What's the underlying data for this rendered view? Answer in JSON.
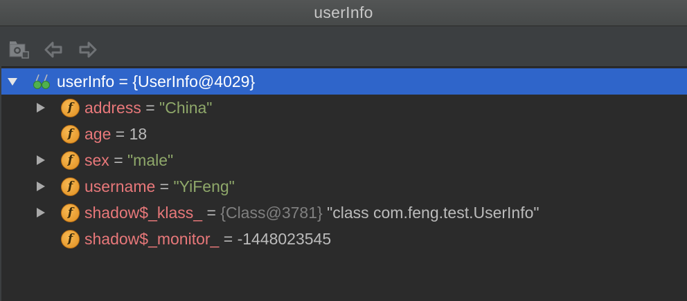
{
  "window": {
    "title": "userInfo"
  },
  "toolbar": {
    "buttons": [
      {
        "icon": "screenshot-icon"
      },
      {
        "icon": "back-arrow-icon"
      },
      {
        "icon": "forward-arrow-icon"
      }
    ]
  },
  "tree": {
    "root": {
      "name": "userInfo",
      "equals": "=",
      "value": "{UserInfo@4029}",
      "icon": "watch-glasses-icon",
      "expanded": true
    },
    "fields": [
      {
        "name": "address",
        "equals": "=",
        "value": "\"China\"",
        "kind": "string",
        "expandable": true,
        "icon_letter": "f"
      },
      {
        "name": "age",
        "equals": "=",
        "value": "18",
        "kind": "number",
        "expandable": false,
        "icon_letter": "f"
      },
      {
        "name": "sex",
        "equals": "=",
        "value": "\"male\"",
        "kind": "string",
        "expandable": true,
        "icon_letter": "f"
      },
      {
        "name": "username",
        "equals": "=",
        "value": "\"YiFeng\"",
        "kind": "string",
        "expandable": true,
        "icon_letter": "f"
      },
      {
        "name": "shadow$_klass_",
        "equals": "=",
        "ref": "{Class@3781}",
        "value": "\"class com.feng.test.UserInfo\"",
        "kind": "object",
        "expandable": true,
        "icon_letter": "f"
      },
      {
        "name": "shadow$_monitor_",
        "equals": "=",
        "value": "-1448023545",
        "kind": "number",
        "expandable": false,
        "icon_letter": "f"
      }
    ]
  },
  "colors": {
    "background": "#3c3f41",
    "tree_background": "#2b2b2b",
    "selection": "#2f65ca",
    "field_name": "#e8787a",
    "string_value": "#8fa86a",
    "field_icon": "#e99d2f"
  }
}
